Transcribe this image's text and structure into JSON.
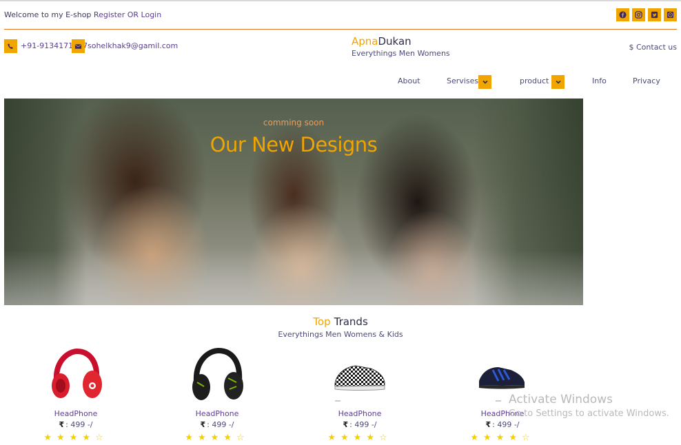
{
  "topbar": {
    "welcome_text": "Welcome to my E-shop",
    "register_label": "Register",
    "or_text": "OR",
    "login_label": "Login",
    "social_icons": [
      "facebook-icon",
      "instagram-icon",
      "twitter-icon",
      "whatsapp-icon"
    ]
  },
  "contact": {
    "phone": "+91-9134171517",
    "email": "sohelkhak9@gamil.com",
    "contact_us": "$ Contact us"
  },
  "brand": {
    "name_part1": "Apna",
    "name_part2": "Dukan",
    "tagline": "Everythings Men Womens"
  },
  "nav": {
    "items": [
      "About",
      "Servises",
      "product",
      "Info",
      "Privacy"
    ]
  },
  "hero": {
    "small_text": "comming soon",
    "big_text": "Our New Designs"
  },
  "section": {
    "title_part1": "Top",
    "title_part2": "Trands",
    "subtitle": "Everythings Men Womens & Kids"
  },
  "products": [
    {
      "name": "HeadPhone",
      "currency": "₹",
      "price": ": 499 -/",
      "stars": "★★★★☆",
      "rating": 4
    },
    {
      "name": "HeadPhone",
      "currency": "₹",
      "price": ": 499 -/",
      "stars": "★★★★☆",
      "rating": 4
    },
    {
      "name": "HeadPhone",
      "currency": "₹",
      "price": ": 499 -/",
      "stars": "★★★★☆",
      "rating": 4
    },
    {
      "name": "HeadPhone",
      "currency": "₹",
      "price": ": 499 -/",
      "stars": "★★★★☆",
      "rating": 4
    }
  ],
  "watermark": {
    "line1": "Activate Windows",
    "line2": "Go to Settings to activate Windows."
  },
  "colors": {
    "accent": "#f0a500",
    "rule": "#e8711d",
    "text_purple": "#5b3e8f",
    "star": "#f5d000"
  }
}
